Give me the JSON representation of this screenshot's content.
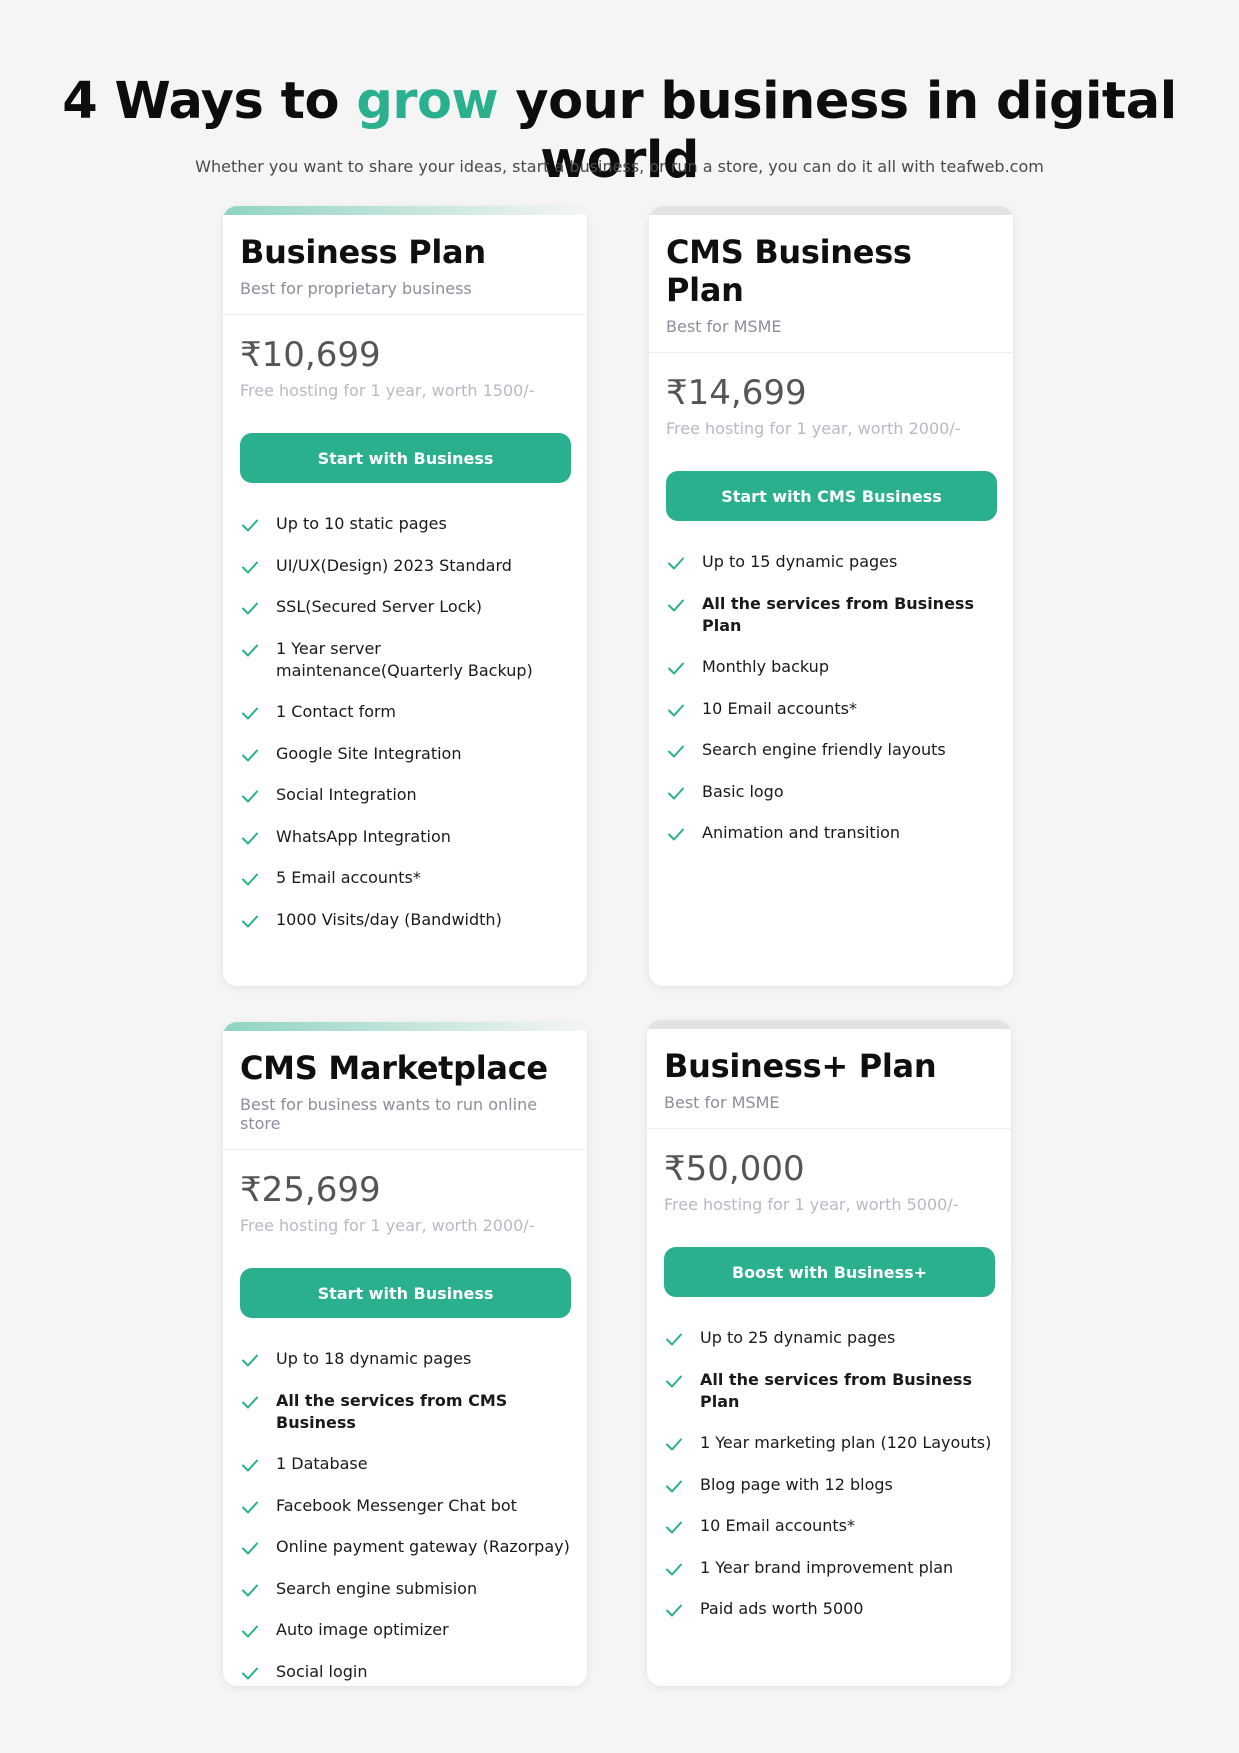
{
  "header": {
    "title_pre": "4 Ways to ",
    "title_accent": "grow",
    "title_post": " your business in digital world",
    "subtitle": "Whether you want to share your ideas, start a business, or run a store, you can do it all with teafweb.com",
    "accent_color": "#2bb08f"
  },
  "plans": [
    {
      "title": "Business Plan",
      "best_for": "Best for proprietary business",
      "price": "₹10,699",
      "hosting": "Free hosting for 1 year,  worth 1500/-",
      "cta": "Start with Business",
      "features": [
        {
          "text": "Up to 10 static pages",
          "bold": false
        },
        {
          "text": "UI/UX(Design) 2023 Standard",
          "bold": false
        },
        {
          "text": " SSL(Secured Server Lock)",
          "bold": false
        },
        {
          "text": "1 Year server maintenance(Quarterly Backup)",
          "bold": false
        },
        {
          "text": "1 Contact form",
          "bold": false
        },
        {
          "text": "Google Site Integration",
          "bold": false
        },
        {
          "text": "Social Integration",
          "bold": false
        },
        {
          "text": "WhatsApp Integration",
          "bold": false
        },
        {
          "text": "5 Email accounts*",
          "bold": false
        },
        {
          "text": "1000 Visits/day (Bandwidth)",
          "bold": false
        }
      ]
    },
    {
      "title": "CMS Business Plan",
      "best_for": "Best for  MSME",
      "price": "₹14,699",
      "hosting": "Free hosting for 1 year, worth 2000/-",
      "cta": "Start with CMS Business",
      "features": [
        {
          "text": "Up to 15 dynamic pages",
          "bold": false
        },
        {
          "text": "All the services from Business Plan",
          "bold": true
        },
        {
          "text": "Monthly backup",
          "bold": false
        },
        {
          "text": "10 Email accounts*",
          "bold": false
        },
        {
          "text": "Search engine friendly layouts",
          "bold": false
        },
        {
          "text": "Basic logo",
          "bold": false
        },
        {
          "text": "Animation and transition",
          "bold": false
        }
      ]
    },
    {
      "title": "CMS Marketplace",
      "best_for": "Best for business wants to run online store",
      "price": "₹25,699",
      "hosting": "Free hosting for 1 year,  worth 2000/-",
      "cta": "Start with Business",
      "features": [
        {
          "text": "Up to 18 dynamic pages",
          "bold": false
        },
        {
          "text": "All the services from CMS Business",
          "bold": true
        },
        {
          "text": "1 Database",
          "bold": false
        },
        {
          "text": "Facebook Messenger Chat bot",
          "bold": false
        },
        {
          "text": "Online payment gateway (Razorpay)",
          "bold": false
        },
        {
          "text": "Search engine submision",
          "bold": false
        },
        {
          "text": "Auto image optimizer",
          "bold": false
        },
        {
          "text": "Social login",
          "bold": false
        }
      ]
    },
    {
      "title": "Business+ Plan",
      "best_for": "Best for  MSME",
      "price": "₹50,000",
      "hosting": "Free hosting for 1 year, worth 5000/-",
      "cta": "Boost with Business+",
      "features": [
        {
          "text": "Up to 25 dynamic pages",
          "bold": false
        },
        {
          "text": "All the services from Business Plan",
          "bold": true
        },
        {
          "text": "1 Year marketing plan (120 Layouts)",
          "bold": false
        },
        {
          "text": "Blog page with 12 blogs",
          "bold": false
        },
        {
          "text": "10 Email accounts*",
          "bold": false
        },
        {
          "text": "1 Year brand improvement plan",
          "bold": false
        },
        {
          "text": "Paid ads worth 5000",
          "bold": false
        }
      ]
    }
  ]
}
